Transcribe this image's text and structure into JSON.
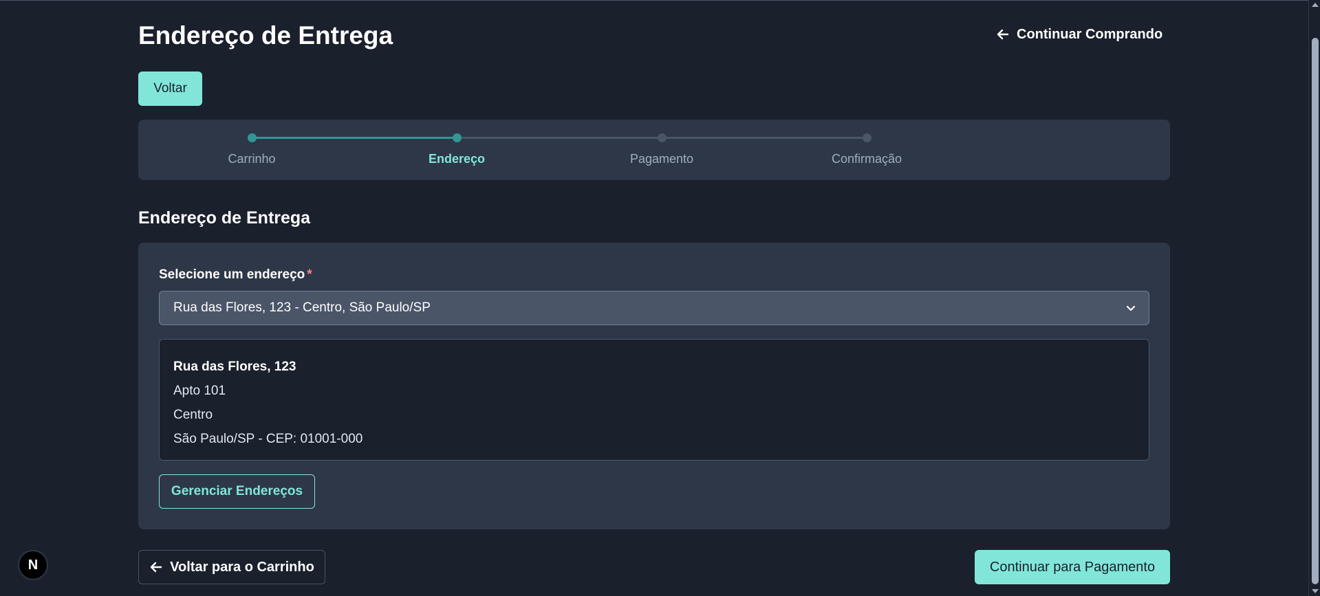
{
  "header": {
    "title": "Endereço de Entrega",
    "continue_shopping_label": "Continuar Comprando",
    "back_button_label": "Voltar"
  },
  "stepper": {
    "steps": [
      {
        "label": "Carrinho",
        "state": "done"
      },
      {
        "label": "Endereço",
        "state": "active"
      },
      {
        "label": "Pagamento",
        "state": "pending"
      },
      {
        "label": "Confirmação",
        "state": "pending"
      }
    ]
  },
  "section": {
    "title": "Endereço de Entrega",
    "select_label": "Selecione um endereço",
    "required_marker": "*",
    "selected_address": "Rua das Flores, 123 - Centro, São Paulo/SP",
    "address_details": {
      "street": "Rua das Flores, 123",
      "complement": "Apto 101",
      "neighborhood": "Centro",
      "city_cep": "São Paulo/SP - CEP: 01001-000"
    },
    "manage_button_label": "Gerenciar Endereços"
  },
  "footer": {
    "back_to_cart_label": "Voltar para o Carrinho",
    "continue_payment_label": "Continuar para Pagamento"
  },
  "badge": {
    "label": "N"
  },
  "colors": {
    "background": "#1a202c",
    "card": "#2d3748",
    "accent": "#81e6d9",
    "progress": "#319795",
    "required": "#fc8181"
  },
  "icons": {
    "back_arrow": "arrow-left-icon",
    "select_chevron": "chevron-down-icon"
  }
}
